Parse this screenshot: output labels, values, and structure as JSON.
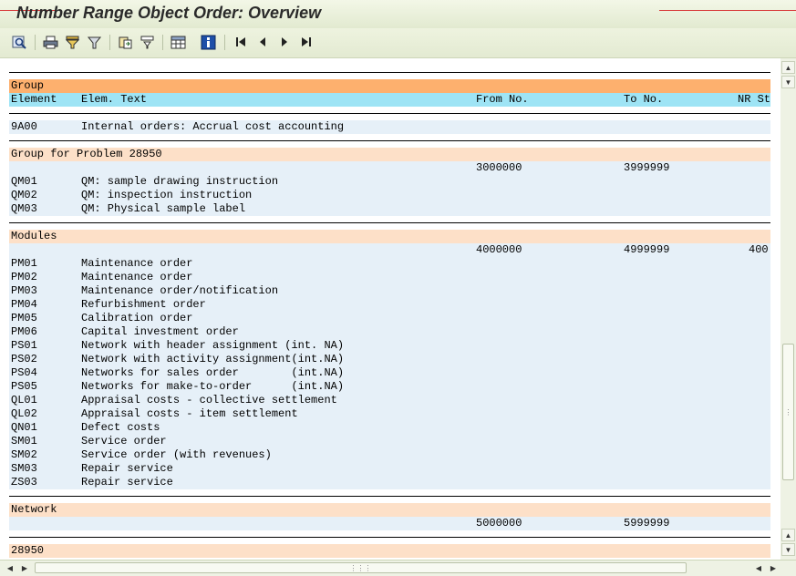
{
  "window": {
    "title": "Number Range Object Order: Overview"
  },
  "toolbar": [
    {
      "name": "find-icon"
    },
    {
      "name": "print-icon"
    },
    {
      "name": "filter-icon"
    },
    {
      "name": "filter-set-icon"
    },
    {
      "name": "export-icon"
    },
    {
      "name": "sort-icon"
    },
    {
      "name": "layout-grid-icon"
    },
    {
      "name": "info-icon"
    },
    {
      "name": "first-page-icon"
    },
    {
      "name": "previous-page-icon"
    },
    {
      "name": "next-page-icon"
    },
    {
      "name": "last-page-icon"
    }
  ],
  "table": {
    "headers": {
      "group": "Group",
      "element": "Element",
      "elem_text": "Elem. Text",
      "from_no": "From No.",
      "to_no": "To No.",
      "nr_status": "NR St"
    },
    "groups": [
      {
        "name": "",
        "range": {
          "from": "",
          "to": "",
          "nr": ""
        },
        "rows": [
          {
            "element": "9A00",
            "text": "Internal orders: Accrual cost accounting"
          }
        ]
      },
      {
        "name": "Group for Problem 28950",
        "range": {
          "from": "3000000",
          "to": "3999999",
          "nr": ""
        },
        "rows": [
          {
            "element": "QM01",
            "text": "QM: sample drawing instruction"
          },
          {
            "element": "QM02",
            "text": "QM: inspection instruction"
          },
          {
            "element": "QM03",
            "text": "QM: Physical sample label"
          }
        ]
      },
      {
        "name": "Modules",
        "range": {
          "from": "4000000",
          "to": "4999999",
          "nr": "400"
        },
        "rows": [
          {
            "element": "PM01",
            "text": "Maintenance order"
          },
          {
            "element": "PM02",
            "text": "Maintenance order"
          },
          {
            "element": "PM03",
            "text": "Maintenance order/notification"
          },
          {
            "element": "PM04",
            "text": "Refurbishment order"
          },
          {
            "element": "PM05",
            "text": "Calibration order"
          },
          {
            "element": "PM06",
            "text": "Capital investment order"
          },
          {
            "element": "PS01",
            "text": "Network with header assignment (int. NA)"
          },
          {
            "element": "PS02",
            "text": "Network with activity assignment(int.NA)"
          },
          {
            "element": "PS04",
            "text": "Networks for sales order        (int.NA)"
          },
          {
            "element": "PS05",
            "text": "Networks for make-to-order      (int.NA)"
          },
          {
            "element": "QL01",
            "text": "Appraisal costs - collective settlement"
          },
          {
            "element": "QL02",
            "text": "Appraisal costs - item settlement"
          },
          {
            "element": "QN01",
            "text": "Defect costs"
          },
          {
            "element": "SM01",
            "text": "Service order"
          },
          {
            "element": "SM02",
            "text": "Service order (with revenues)"
          },
          {
            "element": "SM03",
            "text": "Repair service"
          },
          {
            "element": "ZS03",
            "text": "Repair service"
          }
        ]
      },
      {
        "name": "Network",
        "range": {
          "from": "5000000",
          "to": "5999999",
          "nr": ""
        },
        "rows": []
      },
      {
        "name": "28950",
        "range": {
          "from": "",
          "to": "",
          "nr": ""
        },
        "rows": []
      }
    ]
  }
}
